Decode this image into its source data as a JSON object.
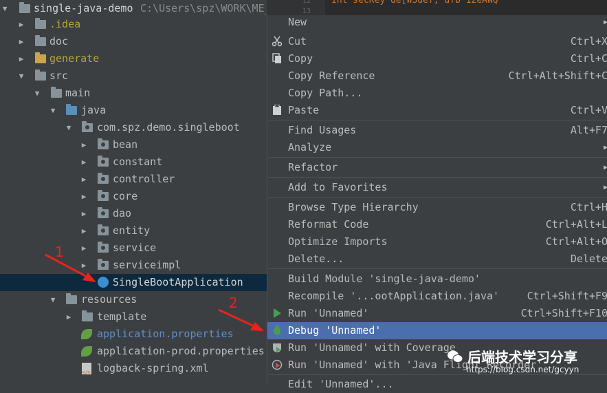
{
  "project": {
    "name": "single-java-demo",
    "path": "C:\\Users\\spz\\WORK\\ME_PI"
  },
  "tree": {
    "idea": ".idea",
    "doc": "doc",
    "generate": "generate",
    "src": "src",
    "main": "main",
    "java": "java",
    "package": "com.spz.demo.singleboot",
    "packages": [
      "bean",
      "constant",
      "controller",
      "core",
      "dao",
      "entity",
      "service",
      "serviceimpl"
    ],
    "app_class": "SingleBootApplication",
    "resources": "resources",
    "template": "template",
    "files": [
      "application.properties",
      "application-prod.properties",
      "logback-spring.xml"
    ]
  },
  "editor": {
    "line_numbers": [
      "12",
      "13"
    ],
    "code": "int secKey de[WSdef, dfb 12eAWQ"
  },
  "menu": [
    {
      "label": "New",
      "shortcut": "",
      "submenu": true,
      "icon": ""
    },
    {
      "label": "Cut",
      "shortcut": "Ctrl+X",
      "icon": "scissors-icon"
    },
    {
      "label": "Copy",
      "shortcut": "Ctrl+C",
      "icon": "copy-icon"
    },
    {
      "label": "Copy Reference",
      "shortcut": "Ctrl+Alt+Shift+C"
    },
    {
      "label": "Copy Path...",
      "shortcut": ""
    },
    {
      "label": "Paste",
      "shortcut": "Ctrl+V",
      "icon": "clipboard-icon"
    },
    {
      "label": "Find Usages",
      "shortcut": "Alt+F7"
    },
    {
      "label": "Analyze",
      "shortcut": "",
      "submenu": true
    },
    {
      "label": "Refactor",
      "shortcut": "",
      "submenu": true
    },
    {
      "label": "Add to Favorites",
      "shortcut": "",
      "submenu": true
    },
    {
      "label": "Browse Type Hierarchy",
      "shortcut": "Ctrl+H"
    },
    {
      "label": "Reformat Code",
      "shortcut": "Ctrl+Alt+L"
    },
    {
      "label": "Optimize Imports",
      "shortcut": "Ctrl+Alt+O"
    },
    {
      "label": "Delete...",
      "shortcut": "Delete"
    },
    {
      "label": "Build Module 'single-java-demo'",
      "shortcut": ""
    },
    {
      "label": "Recompile '...ootApplication.java'",
      "shortcut": "Ctrl+Shift+F9"
    },
    {
      "label": "Run 'Unnamed'",
      "shortcut": "Ctrl+Shift+F10",
      "icon": "run-icon"
    },
    {
      "label": "Debug 'Unnamed'",
      "shortcut": "",
      "icon": "debug-icon",
      "highlighted": true
    },
    {
      "label": "Run 'Unnamed' with Coverage",
      "shortcut": "",
      "icon": "coverage-icon"
    },
    {
      "label": "Run 'Unnamed' with 'Java Flight Recorder'",
      "shortcut": "",
      "icon": "flight-recorder-icon"
    },
    {
      "label": "Edit 'Unnamed'...",
      "shortcut": ""
    }
  ],
  "annotations": {
    "step1": "1",
    "step2": "2"
  },
  "watermark": {
    "title": "后端技术学习分享",
    "url": "https://blog.csdn.net/gcyyn"
  },
  "colors": {
    "accent": "#4b6eaf",
    "selection": "#0d293e",
    "annotation": "#e8231c"
  }
}
